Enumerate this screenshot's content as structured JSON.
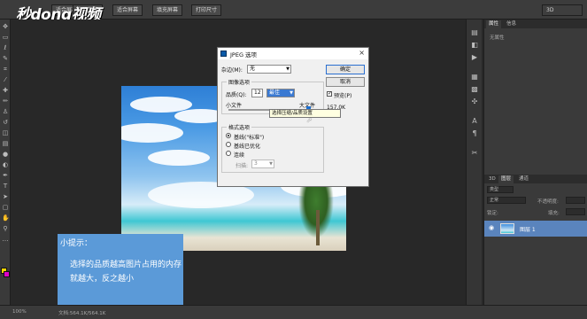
{
  "header": {
    "logo_text": "秒dong视频",
    "buttons": [
      "适合屏幕窗口",
      "实际像素",
      "适合屏幕",
      "填充屏幕",
      "打印尺寸"
    ],
    "workspace_label": "3D"
  },
  "tips": {
    "title": "小提示：",
    "body": "选择的品质越高图片占用的内存就越大，反之越小"
  },
  "dialog": {
    "title": "JPEG 选项",
    "close": "×",
    "matte_label": "杂边(M):",
    "matte_value": "无",
    "image_options_legend": "图像选项",
    "quality_label": "品质(Q):",
    "quality_value": "12",
    "quality_preset": "最佳",
    "small_file": "小文件",
    "large_file": "大文件",
    "format_options_legend": "格式选项",
    "format_options": [
      "基线(\"标准\")",
      "基线已优化",
      "连续"
    ],
    "scans_label": "扫描:",
    "scans_value": "3",
    "ok_button": "确定",
    "cancel_button": "取消",
    "preview_label": "预览(P)",
    "file_size": "157.0K",
    "tooltip": "选择压缩/品质设置"
  },
  "right_panel": {
    "top_tabs": [
      "属性",
      "信息"
    ],
    "properties_empty": "无属性",
    "layer_tabs": [
      "3D",
      "图层",
      "通道"
    ],
    "filter_label": "类型",
    "blend_mode": "正常",
    "opacity_label": "不透明度:",
    "lock_label": "锁定:",
    "fill_label": "填充:",
    "layer_name": "图层 1"
  },
  "status": {
    "zoom": "100%",
    "doc_info": "文档:564.1K/564.1K"
  },
  "colors": {
    "tips_bg": "#5b9ad8",
    "layer_selected": "#5a84bd"
  }
}
